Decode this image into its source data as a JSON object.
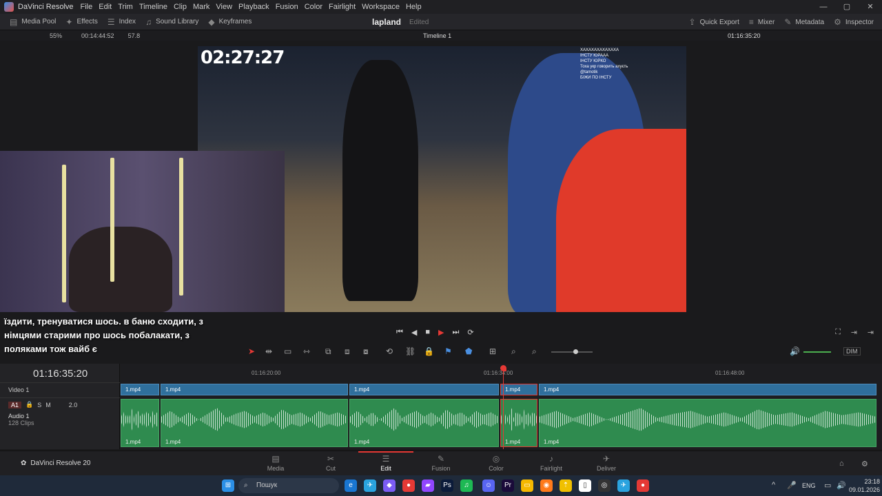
{
  "app": {
    "name": "DaVinci Resolve",
    "version_label": "DaVinci Resolve 20"
  },
  "menu": [
    "File",
    "Edit",
    "Trim",
    "Timeline",
    "Clip",
    "Mark",
    "View",
    "Playback",
    "Fusion",
    "Color",
    "Fairlight",
    "Workspace",
    "Help"
  ],
  "toolbar": {
    "left": [
      {
        "label": "Media Pool",
        "icon": "media-pool-icon"
      },
      {
        "label": "Effects",
        "icon": "effects-icon"
      },
      {
        "label": "Index",
        "icon": "index-icon"
      },
      {
        "label": "Sound Library",
        "icon": "sound-library-icon"
      },
      {
        "label": "Keyframes",
        "icon": "keyframes-icon"
      }
    ],
    "project": "lapland",
    "status": "Edited",
    "right": [
      {
        "label": "Quick Export"
      },
      {
        "label": "Mixer"
      },
      {
        "label": "Metadata"
      },
      {
        "label": "Inspector"
      }
    ]
  },
  "viewerbar": {
    "zoom": "55%",
    "timecode_left": "00:14:44:52",
    "fps": "57.8",
    "timeline_name": "Timeline 1",
    "timecode_right": "01:16:35:20"
  },
  "video": {
    "timer": "02:27:27",
    "chat": [
      "ХАХАХАХАХАХАХА",
      "ІНСТУ ЮРААА",
      "ІНСТУ ЮРКО",
      "Тоха укр говорить ахуєть",
      "@tamotik",
      "БІЖИ ПО ІНСТУ"
    ],
    "subtitle": [
      "їздити, тренуватися шось. в баню сходити, з",
      "німцями старими про шось побалакати, з",
      "поляками тож вайб є"
    ]
  },
  "timeline": {
    "timecode": "01:16:35:20",
    "ruler": [
      "01:16:20:00",
      "01:16:34:00",
      "01:16:48:00"
    ],
    "video_track": {
      "name": "Video 1",
      "clips": [
        "1.mp4",
        "1.mp4",
        "1.mp4",
        "1.mp4",
        "1.mp4"
      ]
    },
    "audio_track": {
      "id": "A1",
      "name": "Audio 1",
      "info": "128 Clips",
      "level": "2.0",
      "clips": [
        "1.mp4",
        "1.mp4",
        "1.mp4",
        "1.mp4",
        "1.mp4"
      ]
    },
    "dim_label": "DIM"
  },
  "pages": [
    "Media",
    "Cut",
    "Edit",
    "Fusion",
    "Color",
    "Fairlight",
    "Deliver"
  ],
  "active_page": "Edit",
  "taskbar": {
    "search": "Пошук",
    "lang": "ENG",
    "time": "23:18",
    "date": "09.01.2026"
  }
}
